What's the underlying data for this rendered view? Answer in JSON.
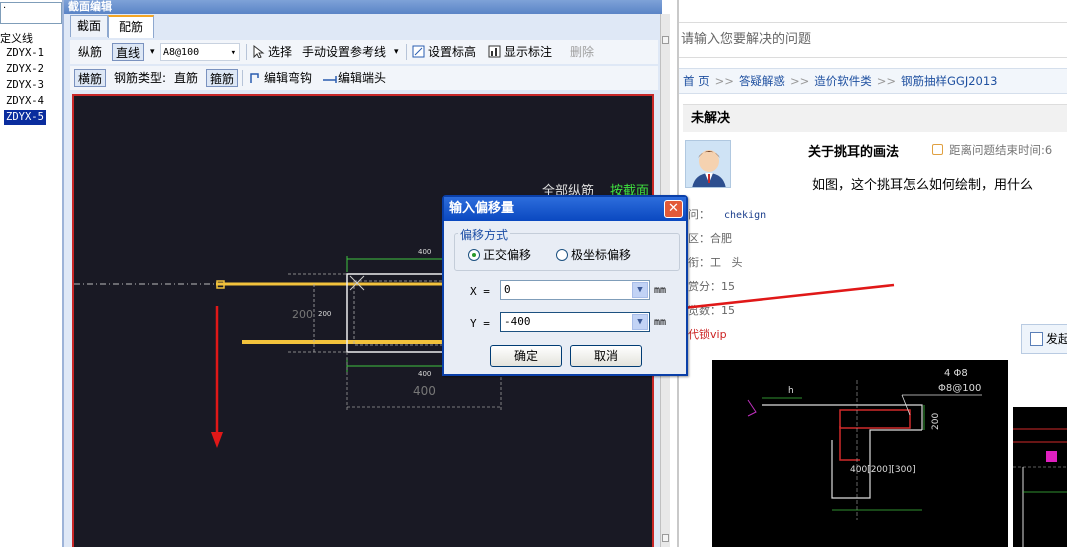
{
  "left_panel": {
    "top_field": "·",
    "heading": "定义线",
    "items": [
      "ZDYX-1",
      "ZDYX-2",
      "ZDYX-3",
      "ZDYX-4",
      "ZDYX-5"
    ],
    "selected_index": 4
  },
  "editor": {
    "title": "截面编辑",
    "tabs": [
      "截面",
      "配筋"
    ],
    "active_tab": "配筋",
    "toolbar1": {
      "rebar_label": "纵筋",
      "line_type": "直线",
      "spec_value": "A8@100",
      "select": "选择",
      "manual_ref": "手动设置参考线",
      "set_elevation": "设置标高",
      "show_annotation": "显示标注",
      "delete": "删除"
    },
    "toolbar2": {
      "transverse": "横筋",
      "rebar_type_label": "钢筋类型:",
      "rebar_type_value": "直筋",
      "stirrup": "箍筋",
      "edit_hook": "编辑弯钩",
      "edit_end": "编辑端头"
    },
    "canvas": {
      "note_white": "全部纵筋",
      "note_green": "按截面",
      "dim_top": "400",
      "dim_side_left": "200",
      "dim_side_right": "200",
      "dim_bottom_small": "400",
      "dim_bottom_large": "400"
    }
  },
  "dialog": {
    "title": "输入偏移量",
    "close": "✕",
    "group_label": "偏移方式",
    "radio_orthogonal": "正交偏移",
    "radio_polar": "极坐标偏移",
    "selected_mode": "正交偏移",
    "x_label": "X =",
    "x_value": "0",
    "y_label": "Y =",
    "y_value": "-400",
    "unit": "mm",
    "ok": "确定",
    "cancel": "取消"
  },
  "forum": {
    "search_placeholder": "请输入您要解决的问题",
    "breadcrumb": [
      "首 页",
      "答疑解惑",
      "造价软件类",
      "钢筋抽样GGJ2013"
    ],
    "breadcrumb_sep": ">>",
    "status": "未解决",
    "question_title": "关于挑耳的画法",
    "time_label": "距离问题结束时间:",
    "time_value": "6",
    "question_body": "如图，这个挑耳怎么如何绘制，用什么",
    "user": {
      "name_label": "问：",
      "name_value": "chekign",
      "region_label": "区：",
      "region_value": "合肥",
      "rank_label": "衔：",
      "rank_value": "工   头",
      "reward_label": "赏分：",
      "reward_value": "15",
      "browse_label": "览数：",
      "browse_value": "15"
    },
    "vip": "代锁vip",
    "post_button": "发起",
    "figure": {
      "label_top": "4 Φ8",
      "label_stirrup": "Φ8@100",
      "label_dim_side": "200",
      "label_dim_bottom": "400[200][300]",
      "label_h": "h"
    }
  },
  "colors": {
    "canvas_bg": "#191924",
    "rebar_yellow": "#f2c23c",
    "arrow_red": "#e01818",
    "dim_green": "#3fc23f"
  }
}
